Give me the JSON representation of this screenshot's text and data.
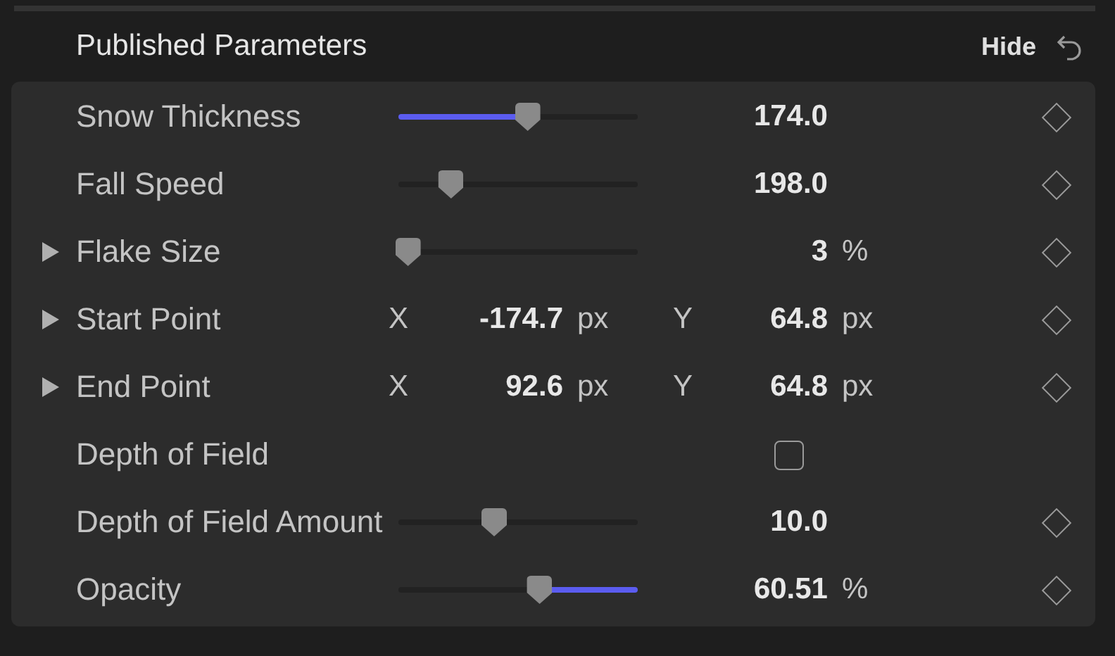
{
  "header": {
    "title": "Published Parameters",
    "hide_label": "Hide"
  },
  "parameters": [
    {
      "kind": "slider",
      "label": "Snow Thickness",
      "expandable": false,
      "level": 0.54,
      "filled": true,
      "fill_reversed": false,
      "value": "174.0"
    },
    {
      "kind": "slider",
      "label": "Fall Speed",
      "expandable": false,
      "level": 0.22,
      "filled": false,
      "value": "198.0"
    },
    {
      "kind": "slider",
      "label": "Flake Size",
      "expandable": true,
      "level": 0.04,
      "filled": false,
      "value": "3",
      "unit": "%"
    },
    {
      "kind": "point",
      "label": "Start Point",
      "expandable": true,
      "x_label": "X",
      "x_value": "-174.7",
      "x_unit": "px",
      "y_label": "Y",
      "y_value": "64.8",
      "y_unit": "px"
    },
    {
      "kind": "point",
      "label": "End Point",
      "expandable": true,
      "x_label": "X",
      "x_value": "92.6",
      "x_unit": "px",
      "y_label": "Y",
      "y_value": "64.8",
      "y_unit": "px"
    },
    {
      "kind": "checkbox",
      "label": "Depth of Field",
      "expandable": false,
      "checked": false
    },
    {
      "kind": "slider",
      "label": "Depth of Field Amount",
      "expandable": false,
      "level": 0.4,
      "filled": false,
      "value": "10.0"
    },
    {
      "kind": "slider",
      "label": "Opacity",
      "expandable": false,
      "level": 0.59,
      "filled": true,
      "fill_reversed": true,
      "value": "60.51",
      "unit": "%"
    }
  ]
}
